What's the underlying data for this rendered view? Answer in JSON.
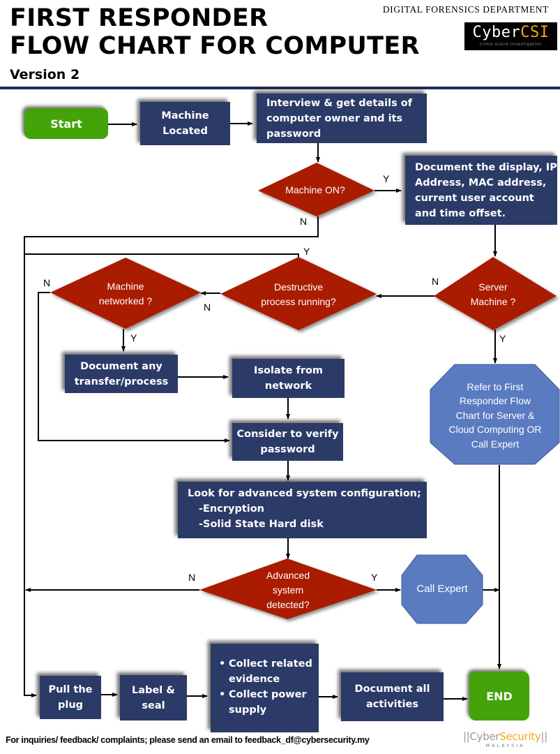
{
  "header": {
    "title_line1": "FIRST RESPONDER",
    "title_line2": "FLOW CHART FOR COMPUTER",
    "version": "Version  2",
    "department": "DIGITAL FORENSICS DEPARTMENT",
    "logo": {
      "prefix": "Cyber",
      "highlight": "CSI",
      "tagline": "crime scene investigation"
    }
  },
  "colors": {
    "process_box": "#2b3a67",
    "decision": "#aa1f00",
    "terminal": "#43a308",
    "octagon": "#5b7bc0",
    "header_rule": "#1f2f5a"
  },
  "nodes": {
    "start": "Start",
    "machine_located": "Machine Located",
    "interview": "Interview & get details of computer owner and its password",
    "machine_on": "Machine ON?",
    "document_display": "Document the display, IP Address, MAC address, current user account and time offset.",
    "server_machine": "Server Machine ?",
    "destructive_process": "Destructive process running?",
    "machine_networked": "Machine networked ?",
    "document_transfer": "Document any transfer/process",
    "isolate_network": "Isolate from network",
    "consider_verify": "Consider to verify password",
    "refer_server": "Refer to First Responder Flow Chart for Server & Cloud Computing OR  Call Expert",
    "look_advanced": {
      "heading": "Look for advanced system configuration;",
      "items": [
        "-Encryption",
        "-Solid State Hard disk"
      ]
    },
    "advanced_detected": "Advanced system detected?",
    "call_expert": "Call Expert",
    "pull_plug": "Pull the plug",
    "label_seal": "Label & seal",
    "collect": [
      "Collect related evidence",
      "Collect power supply"
    ],
    "document_all": "Document all activities",
    "end": "END"
  },
  "edge_labels": {
    "machine_on_yes": "Y",
    "machine_on_no": "N",
    "server_no": "N",
    "server_yes": "Y",
    "destructive_yes": "Y",
    "destructive_no": "N",
    "networked_no": "N",
    "networked_yes": "Y",
    "advanced_no": "N",
    "advanced_yes": "Y"
  },
  "footer": {
    "contact": "For inquiries/ feedback/ complaints; please send an email to feedback_df@cybersecurity.my",
    "logo": {
      "prefix": "Cyber",
      "highlight": "Security",
      "country": "MALAYSIA"
    }
  }
}
